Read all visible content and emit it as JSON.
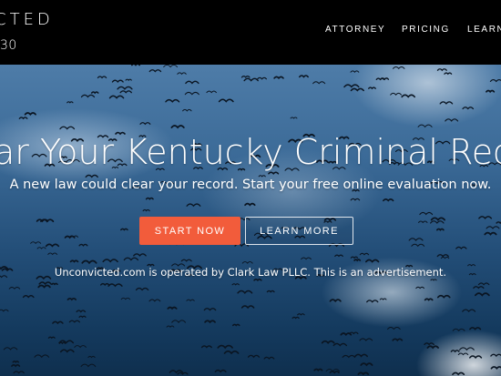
{
  "header": {
    "brand": "CTED",
    "phone": "30",
    "nav": [
      {
        "label": "ATTORNEY"
      },
      {
        "label": "PRICING"
      },
      {
        "label": "LEARN"
      }
    ]
  },
  "hero": {
    "title": "ar Your Kentucky Criminal Reco",
    "subtitle": "A new law could clear your record. Start your free online evaluation now.",
    "start_label": "START NOW",
    "learn_label": "LEARN MORE",
    "disclaimer": "Unconvicted.com is operated by Clark Law PLLC. This is an advertisement."
  },
  "colors": {
    "accent": "#f25c3b",
    "header_bg": "#000000"
  }
}
